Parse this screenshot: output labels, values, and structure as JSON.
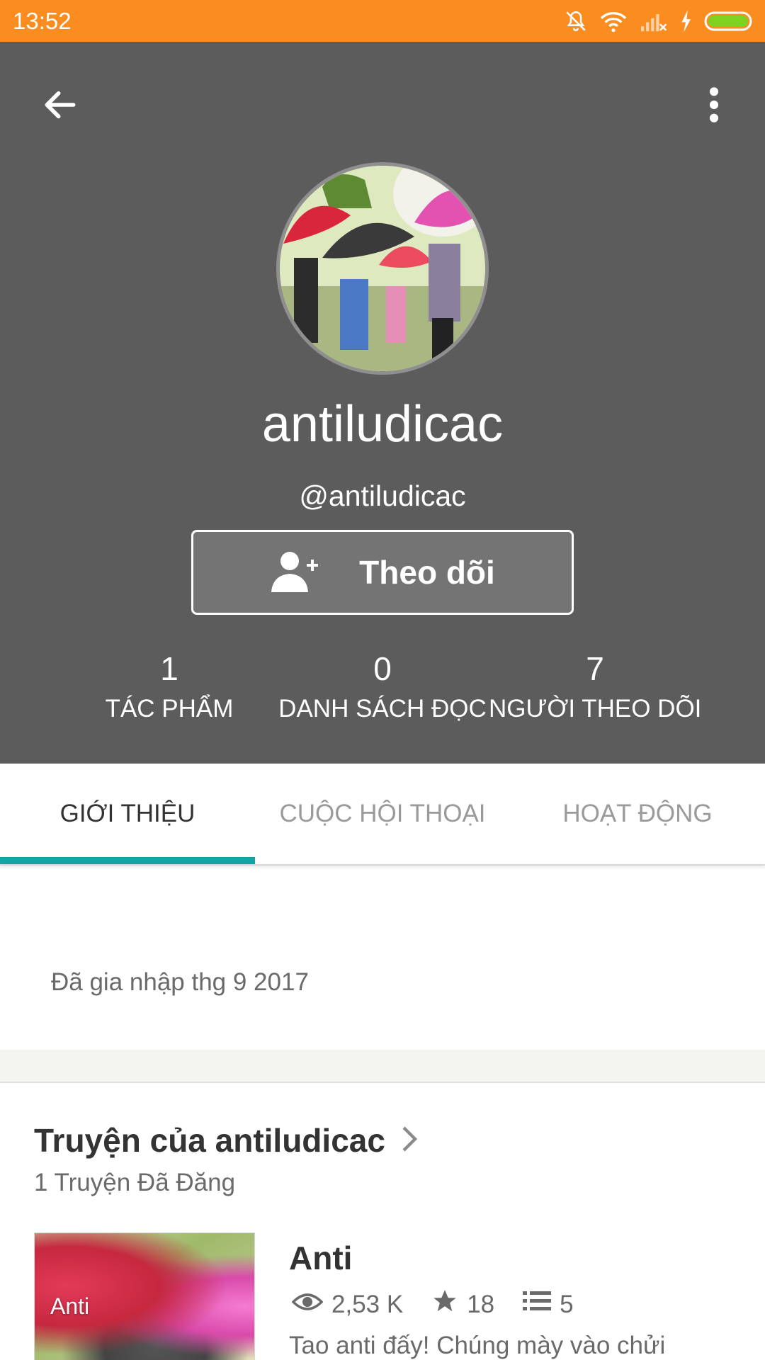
{
  "status_bar": {
    "time": "13:52",
    "icons": [
      "bell-muted-icon",
      "wifi-icon",
      "signal-off-icon",
      "charging-icon",
      "battery-icon"
    ],
    "background_color": "#fb8c1f",
    "battery_color": "#7ed321"
  },
  "header": {
    "background_color": "#5c5c5c",
    "back_icon": "arrow-back-icon",
    "more_icon": "more-vertical-icon",
    "display_name": "antiludicac",
    "username": "@antiludicac",
    "follow_button": {
      "icon": "add-person-icon",
      "label": "Theo dõi"
    },
    "stats": [
      {
        "value": "1",
        "label": "TÁC PHẨM"
      },
      {
        "value": "0",
        "label": "DANH SÁCH ĐỌC"
      },
      {
        "value": "7",
        "label": "NGƯỜI THEO DÕI"
      }
    ]
  },
  "tabs": {
    "items": [
      {
        "label": "GIỚI THIỆU",
        "active": true
      },
      {
        "label": "CUỘC HỘI THOẠI",
        "active": false
      },
      {
        "label": "HOẠT ĐỘNG",
        "active": false
      }
    ],
    "indicator_color": "#14a3a3"
  },
  "about": {
    "joined": "Đã gia nhập thg 9 2017"
  },
  "stories": {
    "title": "Truyện của antiludicac",
    "subtitle": "1 Truyện Đã Đăng",
    "items": [
      {
        "cover_text": "Anti",
        "title": "Anti",
        "reads": "2,53 K",
        "votes": "18",
        "parts": "5",
        "description": "Tao anti đấy! Chúng mày vào chửi"
      }
    ]
  }
}
